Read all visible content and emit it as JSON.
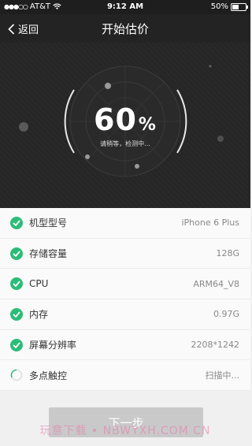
{
  "status_bar": {
    "carrier": "AT&T",
    "time": "9:12 AM",
    "battery": "50%",
    "battery_level": 0.5
  },
  "nav": {
    "back_label": "返回",
    "title": "开始估价"
  },
  "scan": {
    "percent": "60",
    "unit": "%",
    "subtitle": "请稍等，检测中..."
  },
  "items": [
    {
      "label": "机型型号",
      "value": "iPhone 6 Plus",
      "state": "done"
    },
    {
      "label": "存储容量",
      "value": "128G",
      "state": "done"
    },
    {
      "label": "CPU",
      "value": "ARM64_V8",
      "state": "done"
    },
    {
      "label": "内存",
      "value": "0.97G",
      "state": "done"
    },
    {
      "label": "屏幕分辨率",
      "value": "2208*1242",
      "state": "done"
    },
    {
      "label": "多点触控",
      "value": "扫描中...",
      "state": "scanning"
    }
  ],
  "next_button": "下一步",
  "watermark": "玩意下载 • NBWYXH.COM CN",
  "colors": {
    "check": "#2bbd78",
    "dark_bg": "#262626",
    "button": "#c9c9c9"
  }
}
